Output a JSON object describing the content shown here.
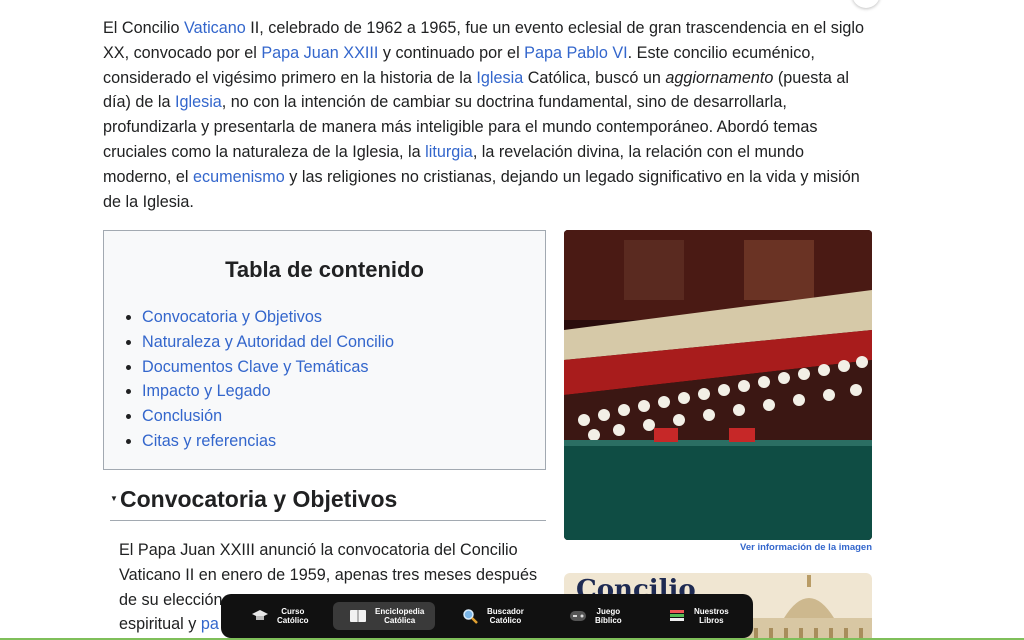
{
  "intro": {
    "s1": "El Concilio ",
    "l1": "Vaticano",
    "s2": " II, celebrado de 1962 a 1965, fue un evento eclesial de gran trascendencia en el siglo XX, convocado por el ",
    "l2": "Papa Juan XXIII",
    "s3": " y continuado por el ",
    "l3": "Papa Pablo VI",
    "s4": ". Este concilio ecuménico, considerado el vigésimo primero en la historia de la ",
    "l4": "Iglesia",
    "s5": " Católica, buscó un ",
    "em": "aggiornamento",
    "s6": " (puesta al día) de la ",
    "l5": "Iglesia",
    "s7": ", no con la intención de cambiar su doctrina fundamental, sino de desarrollarla, profundizarla y presentarla de manera más inteligible para el mundo contemporáneo. Abordó temas cruciales como la naturaleza de la Iglesia, la ",
    "l6": "liturgia",
    "s8": ", la revelación divina, la relación con el mundo moderno, el ",
    "l7": "ecumenismo",
    "s9": " y las religiones no cristianas, dejando un legado significativo en la vida y misión de la Iglesia."
  },
  "toc": {
    "title": "Tabla de contenido",
    "items": [
      "Convocatoria y Objetivos",
      "Naturaleza y Autoridad del Concilio",
      "Documentos Clave y Temáticas",
      "Impacto y Legado",
      "Conclusión",
      "Citas y referencias"
    ]
  },
  "section": {
    "heading": "Convocatoria y Objetivos",
    "para_a": "El Papa Juan XXIII anunció la convocatoria del Concilio Vaticano II en enero de 1959, apenas tres meses después de su elección",
    "para_b": "espiritual y ",
    "para_link": "pa"
  },
  "image": {
    "caption": "Ver información de la imagen"
  },
  "card2": {
    "title": "Concilio"
  },
  "dock": {
    "items": [
      {
        "label1": "Curso",
        "label2": "Católico",
        "icon": "graduation-cap-icon"
      },
      {
        "label1": "Enciclopedia",
        "label2": "Católica",
        "icon": "open-book-icon"
      },
      {
        "label1": "Buscador",
        "label2": "Católico",
        "icon": "search-icon"
      },
      {
        "label1": "Juego",
        "label2": "Bíblico",
        "icon": "gamepad-icon"
      },
      {
        "label1": "Nuestros",
        "label2": "Libros",
        "icon": "books-icon"
      }
    ]
  },
  "colors": {
    "link": "#3366cc",
    "text": "#202122",
    "dock": "#111111",
    "border": "#a2a9b1"
  }
}
